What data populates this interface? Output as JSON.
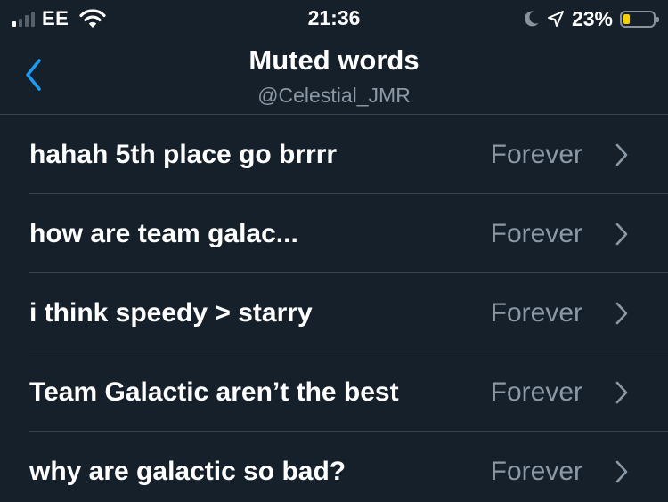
{
  "status_bar": {
    "carrier": "EE",
    "time": "21:36",
    "battery_percent": "23%",
    "signal_bars_active": 1,
    "signal_bars_total": 4,
    "battery_level": 0.23,
    "battery_color": "#f5d300",
    "icons": [
      "signal-icon",
      "wifi-icon",
      "moon-icon",
      "location-arrow-icon",
      "battery-icon"
    ]
  },
  "header": {
    "title": "Muted words",
    "subtitle": "@Celestial_JMR",
    "back_icon": "chevron-left-icon"
  },
  "muted_words": [
    {
      "word": "hahah 5th place go brrrr",
      "duration": "Forever"
    },
    {
      "word": "how are team galac...",
      "duration": "Forever"
    },
    {
      "word": "i think speedy > starry",
      "duration": "Forever"
    },
    {
      "word": "Team Galactic aren’t the best",
      "duration": "Forever"
    },
    {
      "word": "why are galactic so bad?",
      "duration": "Forever"
    }
  ],
  "colors": {
    "background": "#15202b",
    "accent": "#1d9bf0",
    "secondary_text": "#8b98a5",
    "divider": "#38444d"
  }
}
